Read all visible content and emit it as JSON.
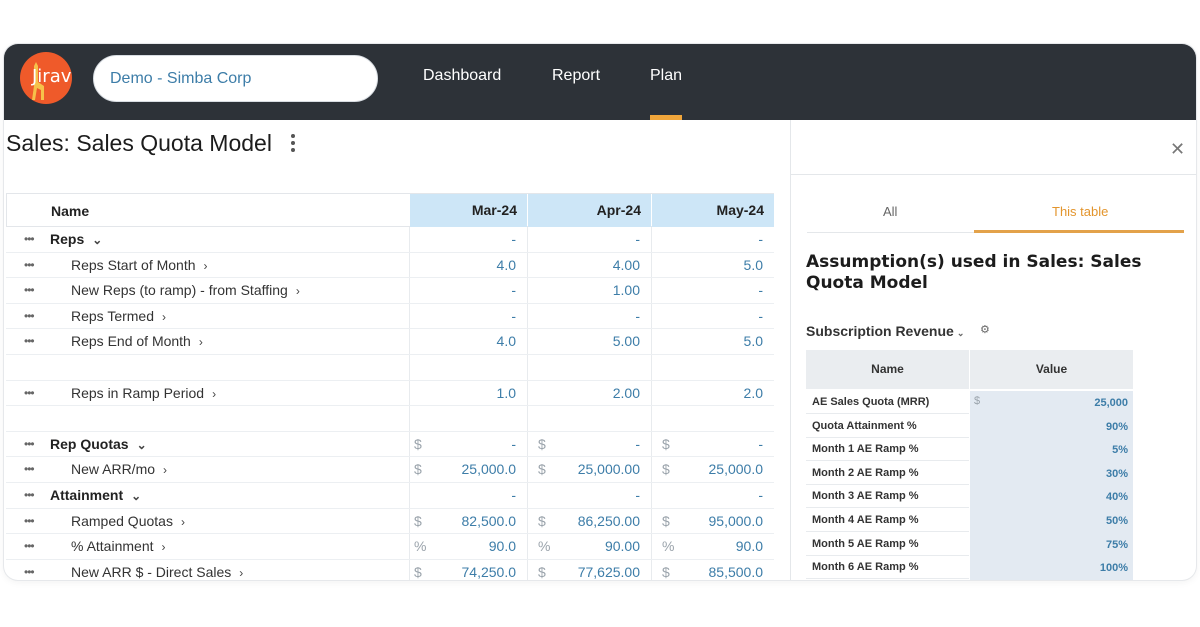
{
  "app": {
    "logo_text": "Jirav",
    "company": "Demo - Simba Corp",
    "nav": [
      "Dashboard",
      "Report",
      "Plan"
    ],
    "active_nav": "Plan",
    "accent_color": "#f0a63b",
    "header_color": "#2d3238"
  },
  "page": {
    "title": "Sales: Sales Quota Model"
  },
  "grid": {
    "name_header": "Name",
    "months": [
      "Mar-24",
      "Apr-24",
      "May-24"
    ],
    "rows": [
      {
        "label": "Reps",
        "group": true,
        "values": [
          "-",
          "-",
          "-"
        ]
      },
      {
        "label": "Reps Start of Month",
        "values": [
          "4.0",
          "4.00",
          "5.0"
        ]
      },
      {
        "label": "New Reps (to ramp) - from Staffing",
        "values": [
          "-",
          "1.00",
          "-"
        ]
      },
      {
        "label": "Reps Termed",
        "values": [
          "-",
          "-",
          "-"
        ]
      },
      {
        "label": "Reps End of Month",
        "values": [
          "4.0",
          "5.00",
          "5.0"
        ]
      },
      {
        "label": "",
        "values": [
          "",
          "",
          ""
        ]
      },
      {
        "label": "Reps in Ramp Period",
        "values": [
          "1.0",
          "2.00",
          "2.0"
        ]
      },
      {
        "label": "",
        "values": [
          "",
          "",
          ""
        ]
      },
      {
        "label": "Rep Quotas",
        "group": true,
        "unit": "$",
        "values": [
          "-",
          "-",
          "-"
        ]
      },
      {
        "label": "New ARR/mo",
        "unit": "$",
        "values": [
          "25,000.0",
          "25,000.00",
          "25,000.0"
        ]
      },
      {
        "label": "Attainment",
        "group": true,
        "values": [
          "-",
          "-",
          "-"
        ]
      },
      {
        "label": "Ramped Quotas",
        "unit": "$",
        "values": [
          "82,500.0",
          "86,250.00",
          "95,000.0"
        ]
      },
      {
        "label": "% Attainment",
        "unit": "%",
        "values": [
          "90.0",
          "90.00",
          "90.0"
        ]
      },
      {
        "label": "New ARR $ - Direct Sales",
        "unit": "$",
        "values": [
          "74,250.0",
          "77,625.00",
          "85,500.0"
        ]
      }
    ]
  },
  "panel": {
    "tabs": [
      "All",
      "This table"
    ],
    "active_tab": "This table",
    "heading": "Assumption(s) used in Sales: Sales Quota Model",
    "section": "Subscription Revenue",
    "table_headers": [
      "Name",
      "Value"
    ],
    "assumptions": [
      {
        "name": "AE Sales Quota (MRR)",
        "currency": "$",
        "value": "25,000"
      },
      {
        "name": "Quota Attainment %",
        "value": "90%"
      },
      {
        "name": "Month 1 AE Ramp %",
        "value": "5%"
      },
      {
        "name": "Month 2 AE Ramp %",
        "value": "30%"
      },
      {
        "name": "Month 3 AE Ramp %",
        "value": "40%"
      },
      {
        "name": "Month 4 AE Ramp %",
        "value": "50%"
      },
      {
        "name": "Month 5 AE Ramp %",
        "value": "75%"
      },
      {
        "name": "Month 6 AE Ramp %",
        "value": "100%"
      }
    ]
  }
}
